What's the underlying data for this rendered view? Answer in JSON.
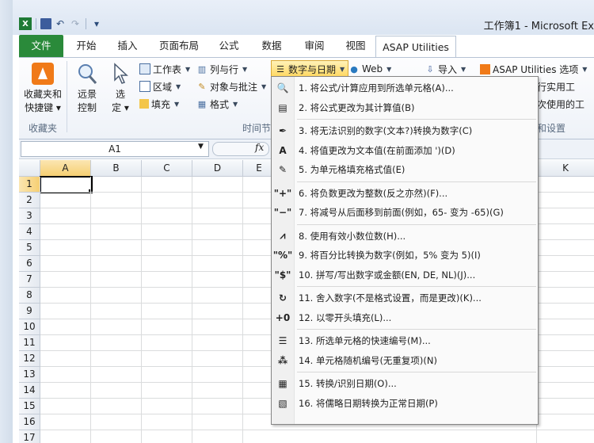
{
  "window": {
    "title": "工作簿1 - Microsoft Ex"
  },
  "qat": {
    "save_icon": "save-icon",
    "undo": "↶",
    "redo": "↷",
    "customize": "▾"
  },
  "tabs": [
    "文件",
    "开始",
    "插入",
    "页面布局",
    "公式",
    "数据",
    "审阅",
    "视图",
    "ASAP Utilities"
  ],
  "ribbon": {
    "favorites": {
      "label_line1": "收藏夹和",
      "label_line2": "快捷键 ▾",
      "group": "收藏夹"
    },
    "remote": {
      "line1": "远景",
      "line2": "控制"
    },
    "select": {
      "line1": "选",
      "line2": "定 ▾"
    },
    "worksheet": "工作表",
    "range": "区域",
    "fill": "填充",
    "columns_rows": "列与行",
    "objects_comments": "对象与批注",
    "format": "格式",
    "numbers_dates": "数字与日期",
    "web": "Web",
    "import": "导入",
    "asap_options": "ASAP Utilities 选项",
    "time_group": "时间节",
    "right_item1": "行实用工",
    "right_item2": "次使用的工",
    "right_group": "和设置"
  },
  "formula_bar": {
    "cell_ref": "A1",
    "fx": "fx"
  },
  "columns": [
    "A",
    "B",
    "C",
    "D",
    "E",
    "K"
  ],
  "rows": [
    "1",
    "2",
    "3",
    "4",
    "5",
    "6",
    "7",
    "8",
    "9",
    "10",
    "11",
    "12",
    "13",
    "14",
    "15",
    "16",
    "17"
  ],
  "menu": {
    "items": [
      {
        "label": "1. 将公式/计算应用到所选单元格(A)...",
        "icon": "formula-icon"
      },
      {
        "label": "2. 将公式更改为其计算值(B)",
        "icon": "paste-value-icon"
      },
      {
        "label": "3. 将无法识别的数字(文本?)转换为数字(C)",
        "icon": "convert-icon"
      },
      {
        "label": "4. 将值更改为文本值(在前面添加 ')(D)",
        "icon": "text-icon"
      },
      {
        "label": "5. 为单元格填充格式值(E)",
        "icon": "brush-icon"
      },
      {
        "label": "6. 将负数更改为整数(反之亦然)(F)...",
        "icon": "plus-minus-icon"
      },
      {
        "label": "7. 将减号从后面移到前面(例如，65- 变为 -65)(G)",
        "icon": "minus-icon"
      },
      {
        "label": "8. 使用有效小数位数(H)...",
        "icon": "decimal-icon"
      },
      {
        "label": "9. 将百分比转换为数字(例如，5% 变为 5)(I)",
        "icon": "percent-icon"
      },
      {
        "label": "10. 拼写/写出数字或金额(EN, DE, NL)(J)...",
        "icon": "dollar-icon"
      },
      {
        "label": "11. 舍入数字(不是格式设置，而是更改)(K)...",
        "icon": "round-icon"
      },
      {
        "label": "12. 以零开头填充(L)...",
        "icon": "zero-fill-icon"
      },
      {
        "label": "13. 所选单元格的快速编号(M)...",
        "icon": "numbering-icon"
      },
      {
        "label": "14. 单元格随机编号(无重复项)(N)",
        "icon": "random-icon"
      },
      {
        "label": "15. 转换/识别日期(O)...",
        "icon": "date-icon"
      },
      {
        "label": "16. 将儒略日期转换为正常日期(P)",
        "icon": "julian-icon"
      }
    ]
  },
  "colors": {
    "file_tab": "#2a8a3a",
    "accent": "#f7a02a",
    "selected_border": "#000000"
  }
}
